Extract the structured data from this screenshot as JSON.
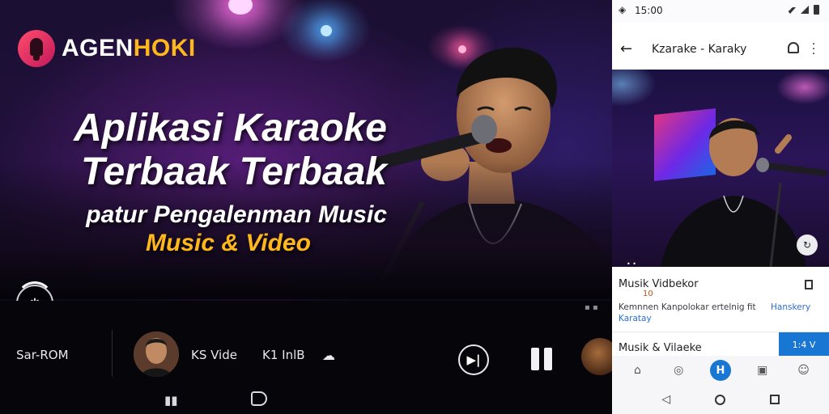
{
  "brand": {
    "part1": "AGEN",
    "part2": "HOKI"
  },
  "headline": {
    "line1": "Aplikasi Karaoke",
    "line2": "Terbaak Terbaak",
    "line3": "patur Pengalenman Music",
    "line4": "Music & Video"
  },
  "player": {
    "left_label": "Sar-ROM",
    "track_title": "KS Vide",
    "track_sub": "K1 InlB",
    "cloud_icon": "cloud-icon",
    "next_icon": "skip-next-icon",
    "pause_icon": "pause-icon"
  },
  "phone": {
    "status_time": "15:00",
    "appbar_title": "Kzarake - Karaky",
    "section1": {
      "title": "Musik Vidbekor",
      "badge": "10",
      "desc_line1": "Kemnnen  Kanpolokar ertelnig fit",
      "desc_link": "Hanskery",
      "desc_line2": "Karatay"
    },
    "section2": {
      "title": "Musik & Vilaeke",
      "button": "1:4 V"
    },
    "tabbar": {
      "active_label": "H"
    },
    "video_dots": "• •"
  },
  "colors": {
    "accent_yellow": "#ffb81c",
    "brand_red": "#ff4d6d",
    "phone_accent": "#1976d2"
  }
}
